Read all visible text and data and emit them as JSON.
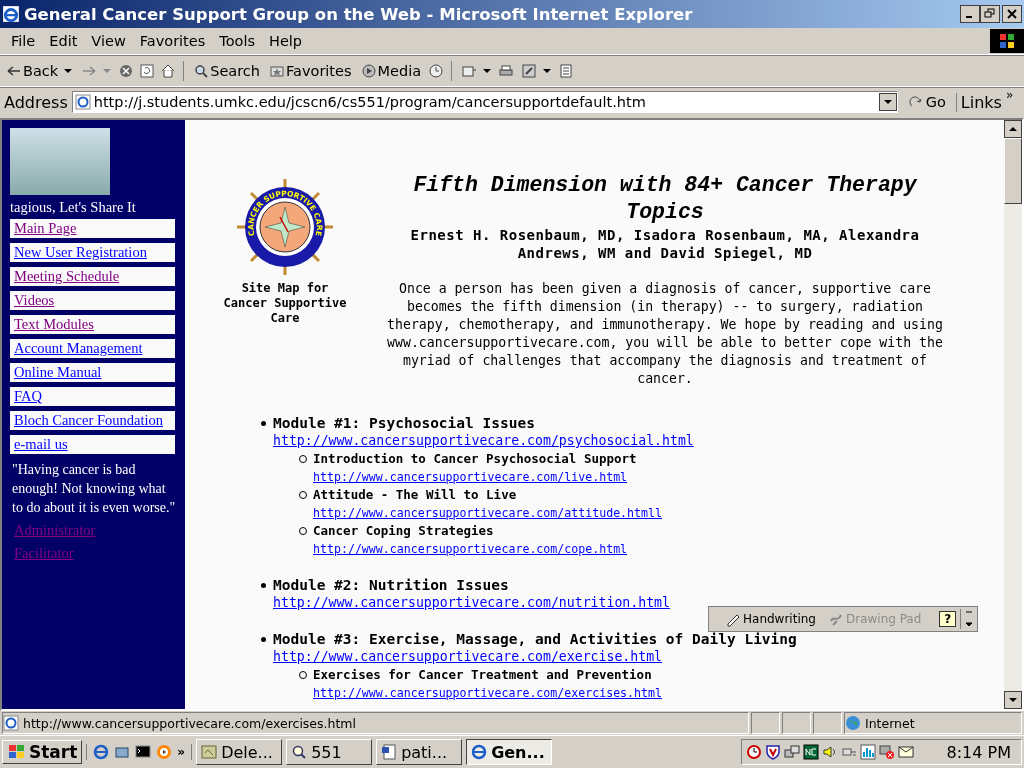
{
  "window": {
    "title": "General Cancer Support Group on the Web - Microsoft Internet Explorer"
  },
  "menu": [
    "File",
    "Edit",
    "View",
    "Favorites",
    "Tools",
    "Help"
  ],
  "toolbar": [
    {
      "kind": "back",
      "label": "Back"
    },
    {
      "kind": "forward"
    },
    {
      "kind": "stop"
    },
    {
      "kind": "refresh"
    },
    {
      "kind": "home"
    },
    {
      "kind": "search",
      "label": "Search"
    },
    {
      "kind": "favorites",
      "label": "Favorites"
    },
    {
      "kind": "media",
      "label": "Media"
    },
    {
      "kind": "history"
    },
    {
      "kind": "mail"
    },
    {
      "kind": "print"
    },
    {
      "kind": "edit"
    },
    {
      "kind": "discuss"
    }
  ],
  "address": {
    "label": "Address",
    "value": "http://j.students.umkc.edu/jcscn6/cs551/program/cancersupportdefault.htm",
    "go": "Go",
    "links": "Links",
    "more": "»"
  },
  "sidebar": {
    "tagline": "tagious, Let's Share It",
    "links": [
      {
        "label": "Main Page",
        "visited": true
      },
      {
        "label": "New User Registration",
        "visited": false
      },
      {
        "label": "Meeting Schedule",
        "visited": true
      },
      {
        "label": "Videos",
        "visited": true
      },
      {
        "label": "Text Modules",
        "visited": true
      },
      {
        "label": "Account Management",
        "visited": false
      },
      {
        "label": "Online Manual",
        "visited": false
      },
      {
        "label": "FAQ",
        "visited": false
      },
      {
        "label": "Bloch Cancer Foundation",
        "visited": false
      },
      {
        "label": "e-mail us",
        "visited": false
      }
    ],
    "quote": "\"Having cancer is bad enough! Not knowing what to do about it is even worse.\"",
    "staff_links": [
      {
        "label": "Administrator",
        "visited": true
      },
      {
        "label": "Facilitator",
        "visited": true
      }
    ]
  },
  "page": {
    "logo_text": "CANCER SUPPORTIVE CARE",
    "sitemap_caption": "Site Map for Cancer Supportive Care",
    "title": "Fifth Dimension with 84+ Cancer Therapy Topics",
    "authors": "Ernest H. Rosenbaum, MD, Isadora Rosenbaum, MA, Alexandra Andrews, WM and David Spiegel, MD",
    "intro": "Once a person has been given a diagnosis of cancer, supportive care becomes the fifth dimension (in therapy) -- to surgery, radiation therapy, chemotherapy, and immunotherapy. We hope by reading and using www.cancersupportivecare.com, you will be able to better cope with the myriad of challenges that accompany the diagnosis and treatment of cancer.",
    "modules": [
      {
        "title": "Module #1: Psychosocial Issues",
        "url": "http://www.cancersupportivecare.com/psychosocial.html",
        "topics": [
          {
            "title": "Introduction to Cancer Psychosocial Support",
            "url": "http://www.cancersupportivecare.com/live.html"
          },
          {
            "title": "Attitude - The Will to Live",
            "url": "http://www.cancersupportivecare.com/attitude.htmll"
          },
          {
            "title": "Cancer Coping Strategies",
            "url": "http://www.cancersupportivecare.com/cope.html"
          }
        ]
      },
      {
        "title": "Module #2: Nutrition Issues",
        "url": "http://www.cancersupportivecare.com/nutrition.html"
      },
      {
        "title": "Module #3: Exercise, Massage, and Activities of Daily Living",
        "url": "http://www.cancersupportivecare.com/exercise.html",
        "topics": [
          {
            "title": "Exercises for Cancer Treatment and Prevention",
            "url": "http://www.cancersupportivecare.com/exercises.html"
          }
        ]
      }
    ]
  },
  "handwriting_bar": {
    "buttons": [
      {
        "kind": "pen",
        "label": "Handwriting",
        "disabled": false
      },
      {
        "kind": "pad",
        "label": "Drawing Pad",
        "disabled": true
      },
      {
        "kind": "help",
        "label": "?",
        "disabled": false
      }
    ]
  },
  "status_bar": {
    "text": "http://www.cancersupportivecare.com/exercises.html",
    "zone": "Internet"
  },
  "taskbar": {
    "start": "Start",
    "more": "»",
    "tasks": [
      {
        "kind": "explorer",
        "label": "Dele...",
        "selected": false
      },
      {
        "kind": "search",
        "label": "551",
        "selected": false
      },
      {
        "kind": "word",
        "label": "pati...",
        "selected": false
      },
      {
        "kind": "ie",
        "label": "Gen...",
        "selected": true
      }
    ],
    "clock": "8:14 PM"
  }
}
